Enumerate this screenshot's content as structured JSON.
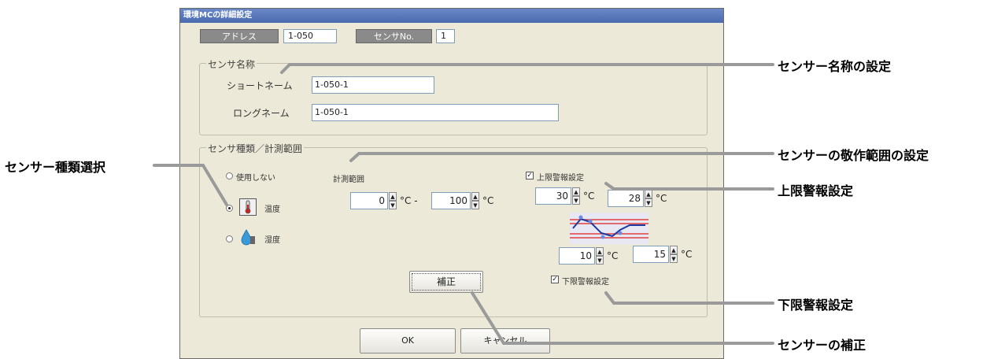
{
  "window": {
    "title": "環境MCの詳細設定"
  },
  "header": {
    "address_label": "アドレス",
    "address_value": "1-050",
    "sensor_no_label": "センサNo.",
    "sensor_no_value": "1"
  },
  "sensor_name": {
    "group_title": "センサ名称",
    "short_label": "ショートネーム",
    "short_value": "1-050-1",
    "long_label": "ロングネーム",
    "long_value": "1-050-1"
  },
  "sensor_type": {
    "group_title": "センサ種類／計測範囲",
    "options": [
      {
        "label": "使用しない",
        "selected": false
      },
      {
        "label": "温度",
        "selected": true,
        "icon": "thermometer-icon"
      },
      {
        "label": "湿度",
        "selected": false,
        "icon": "humidity-drop-icon"
      }
    ],
    "measure_range_label": "計測範囲",
    "range_min": "0",
    "range_max": "100",
    "unit_c": "°C",
    "unit_c_dash": "°C -",
    "upper_alarm_label": "上限警報設定",
    "upper_alarm_checked": true,
    "upper_value": "30",
    "upper_reset": "28",
    "lower_value": "10",
    "lower_reset": "15",
    "lower_alarm_label": "下限警報設定",
    "lower_alarm_checked": true,
    "correct_button": "補正"
  },
  "footer": {
    "ok": "OK",
    "cancel": "キャンセル"
  },
  "callouts": {
    "sensor_name": "センサー名称の設定",
    "sensor_type": "センサー種類選択",
    "range": "センサーの敬作範囲の設定",
    "upper": "上限警報設定",
    "lower": "下限警報設定",
    "correct": "センサーの補正"
  },
  "colors": {
    "title_bar": "#4a6ab0",
    "dialog_bg": "#ece9d8",
    "header_box": "#8a8a8a",
    "leader": "#9a9a9a"
  }
}
